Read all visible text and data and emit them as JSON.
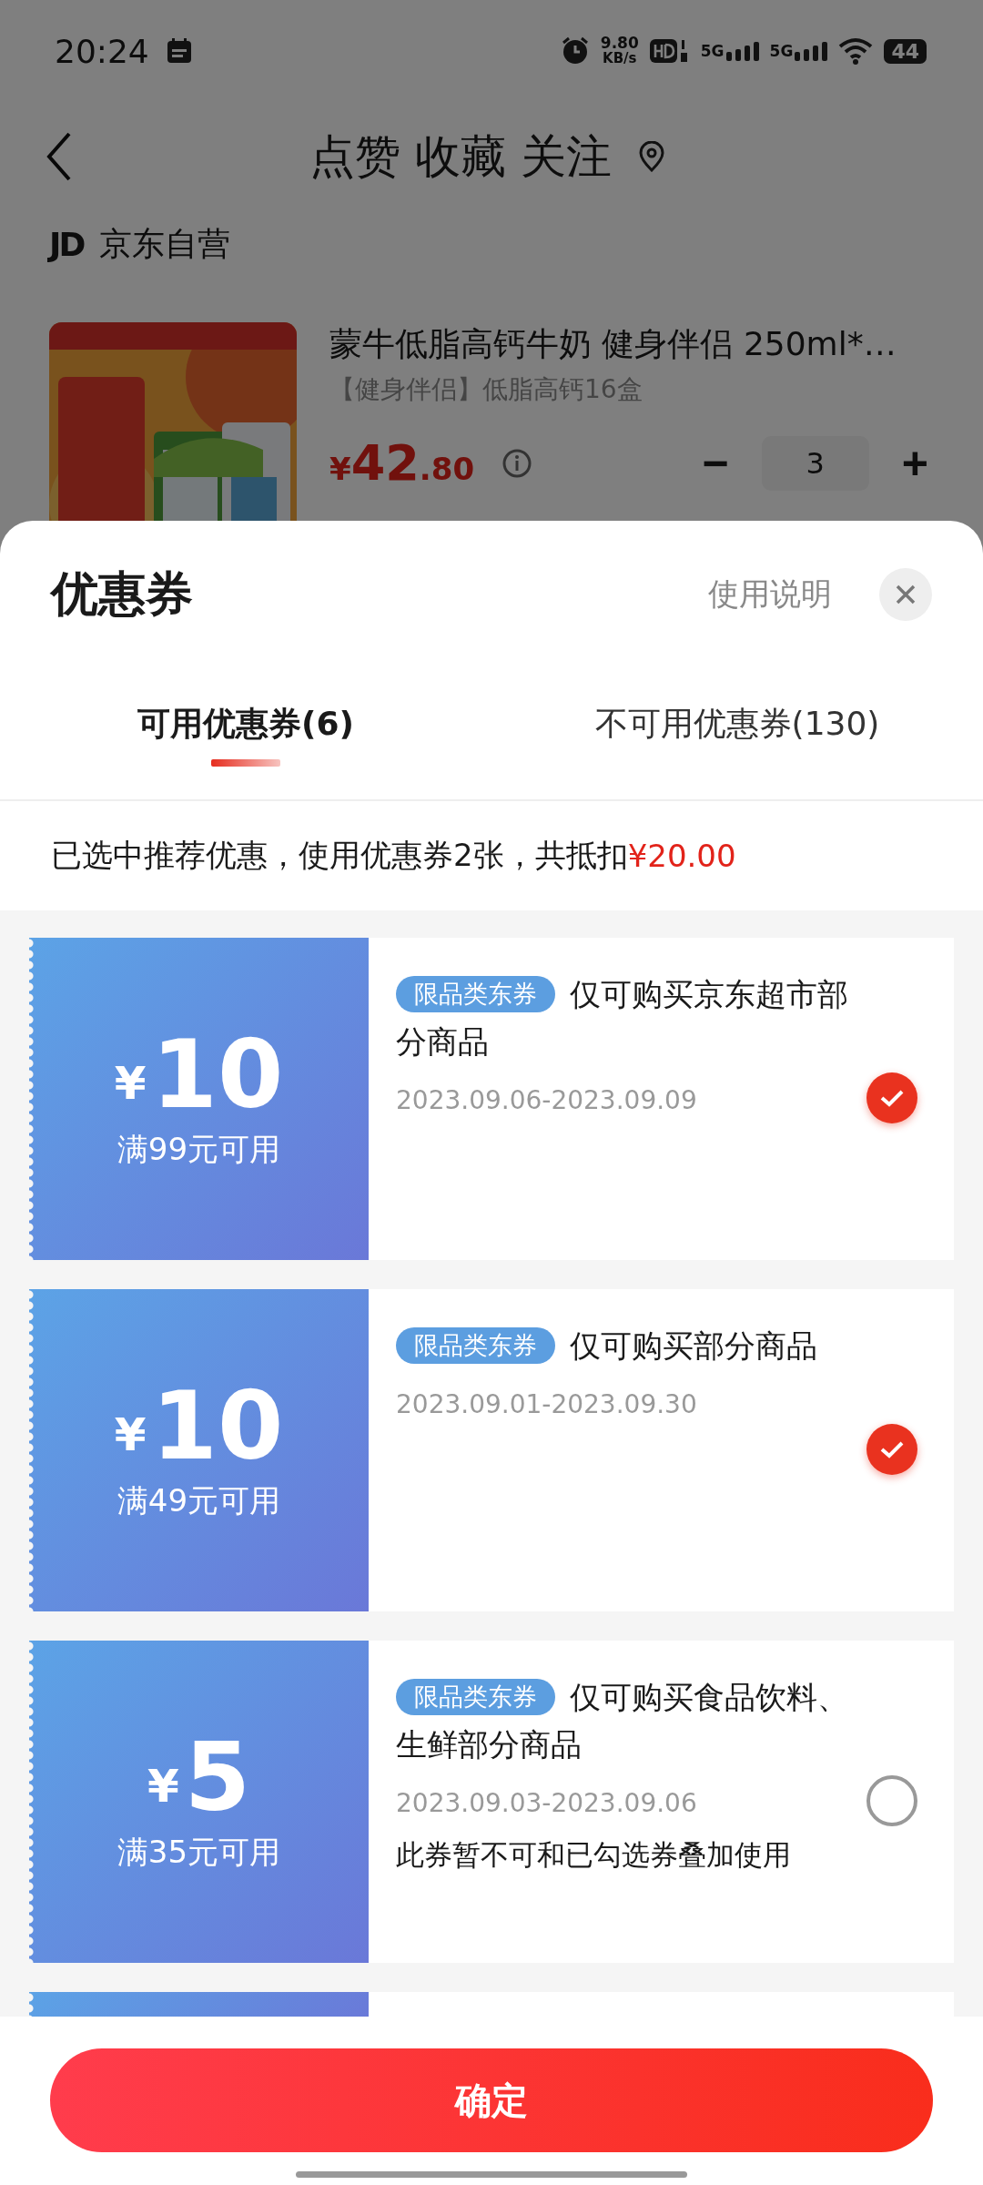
{
  "status_bar": {
    "time": "20:24",
    "speed_value": "9.80",
    "speed_unit": "KB/s",
    "networks": [
      "5G",
      "5G"
    ],
    "battery": "44"
  },
  "header": {
    "title": "点赞 收藏 关注"
  },
  "store": {
    "logo": "JD",
    "name": "京东自营"
  },
  "product": {
    "title": "蒙牛低脂高钙牛奶 健身伴侣 250ml*…",
    "spec": "【健身伴侣】低脂高钙16盒",
    "price_symbol": "¥",
    "price_integer": "42",
    "price_decimal": ".80",
    "quantity": "3",
    "minus": "−",
    "plus": "+"
  },
  "sheet": {
    "title": "优惠券",
    "help_link": "使用说明",
    "tabs": [
      {
        "label": "可用优惠券(6)",
        "selected": true
      },
      {
        "label": "不可用优惠券(130)",
        "selected": false
      }
    ],
    "summary": {
      "text": "已选中推荐优惠，使用优惠券2张，共抵扣",
      "amount": "¥20.00"
    },
    "coupons": [
      {
        "kind": "full",
        "symbol": "¥",
        "amount": "10",
        "condition": "满99元可用",
        "tag": "限品类东券",
        "description": "仅可购买京东超市部分商品",
        "dates": "2023.09.06-2023.09.09",
        "selected": true
      },
      {
        "kind": "full",
        "symbol": "¥",
        "amount": "10",
        "condition": "满49元可用",
        "tag": "限品类东券",
        "description": "仅可购买部分商品",
        "dates": "2023.09.01-2023.09.30",
        "selected": true
      },
      {
        "kind": "full",
        "symbol": "¥",
        "amount": "5",
        "condition": "满35元可用",
        "tag": "限品类东券",
        "description": "仅可购买食品饮料、生鲜部分商品",
        "dates": "2023.09.03-2023.09.06",
        "note": "此券暂不可和已勾选券叠加使用",
        "selected": false
      },
      {
        "kind": "cut_off"
      }
    ],
    "confirm_button": "确定"
  }
}
